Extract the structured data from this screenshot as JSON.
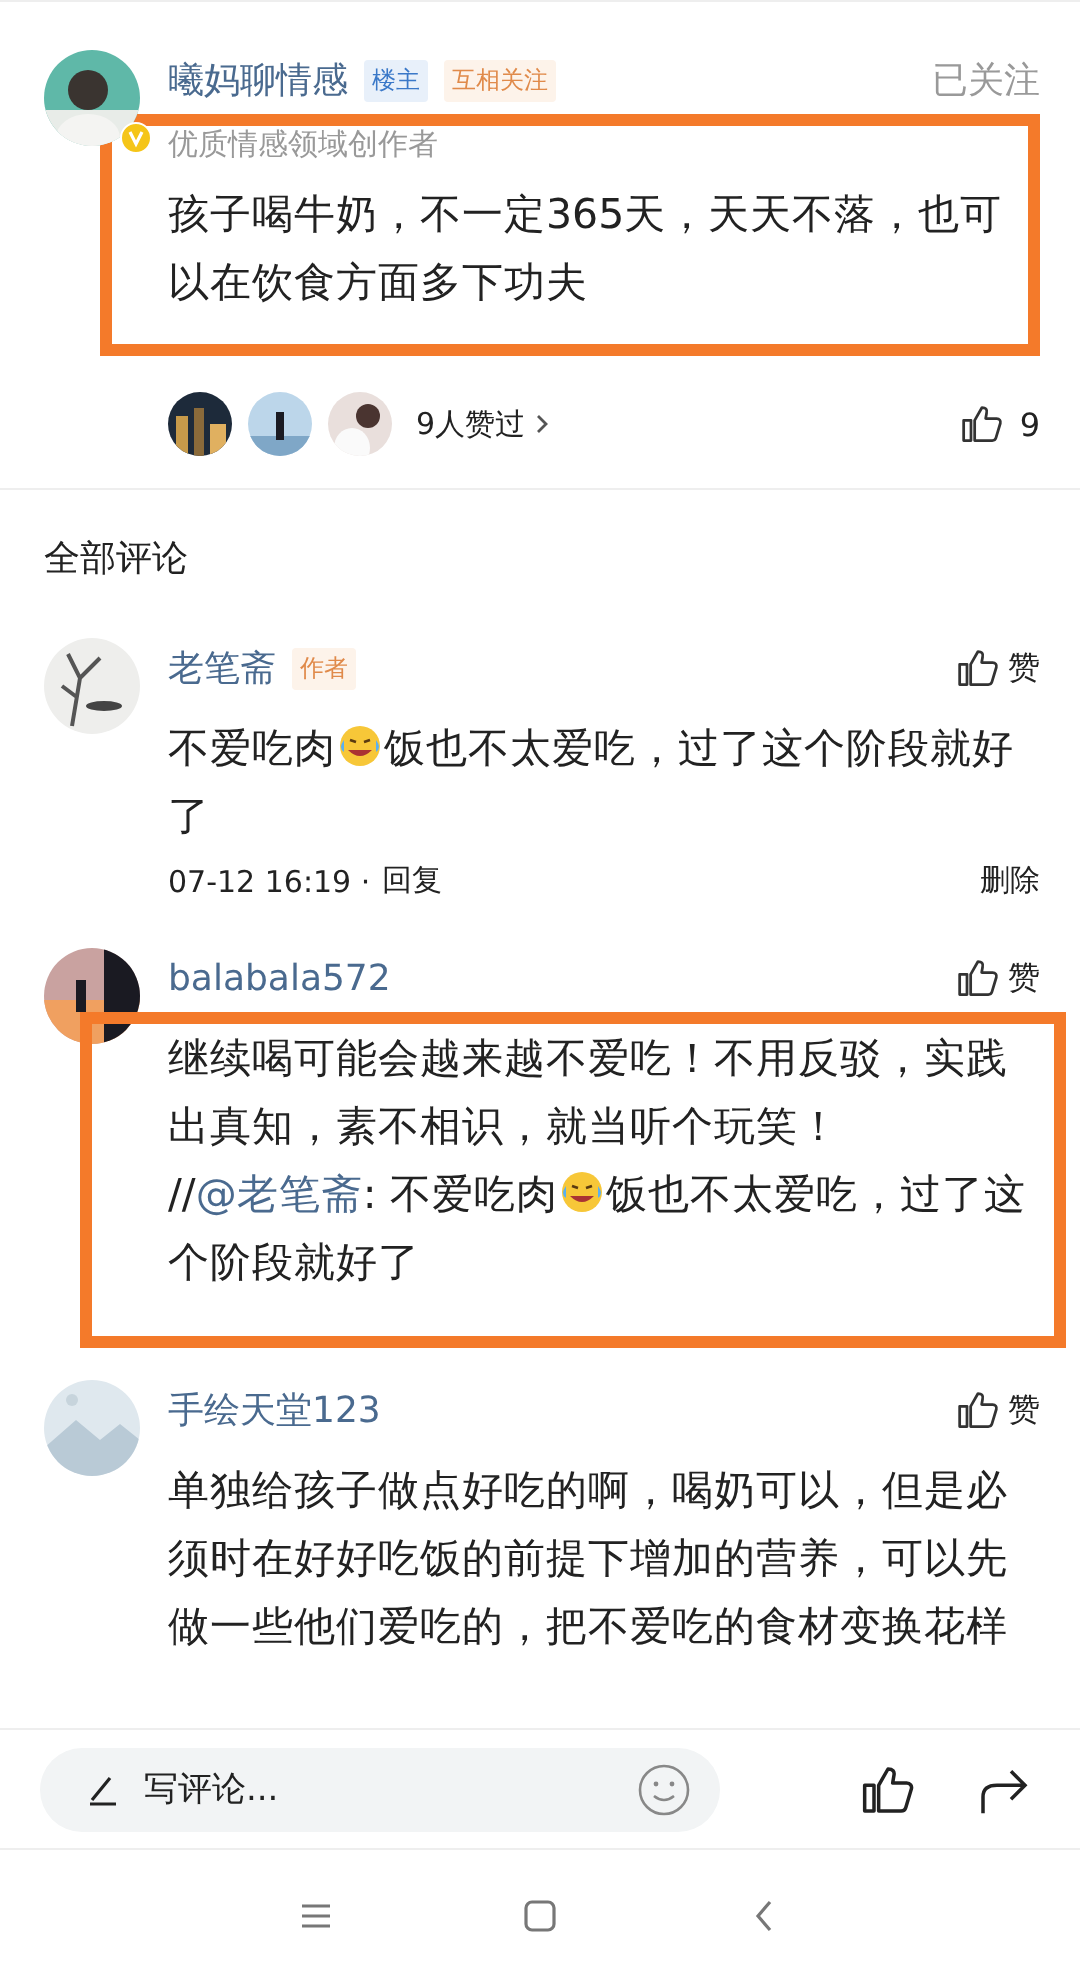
{
  "op_comment": {
    "author": "曦妈聊情感",
    "badges": [
      {
        "kind": "host",
        "text": "楼主"
      },
      {
        "kind": "mutual",
        "text": "互相关注"
      }
    ],
    "follow_status": "已关注",
    "verified": true,
    "highlighted": true,
    "subtitle": "优质情感领域创作者",
    "text": "孩子喝牛奶，不一定365天，天天不落，也可以在饮食方面多下功夫",
    "liked_by": "9人赞过",
    "like_count": "9"
  },
  "section_title": "全部评论",
  "comments": [
    {
      "author": "老笔斋",
      "badges": [
        {
          "kind": "author",
          "text": "作者"
        }
      ],
      "like_label": "赞",
      "highlighted": false,
      "content": [
        {
          "kind": "text",
          "text": "不爱吃肉"
        },
        {
          "kind": "emoji"
        },
        {
          "kind": "text",
          "text": "饭也不太爱吃，过了这个阶段就好了"
        }
      ],
      "time": "07-12 16:19 ·",
      "reply": "回复",
      "delete": "删除"
    },
    {
      "author": "balabala572",
      "like_label": "赞",
      "highlighted": true,
      "content": [
        {
          "kind": "text",
          "text": "继续喝可能会越来越不爱吃！不用反驳，实践出真知，素不相识，就当听个玩笑！ //"
        },
        {
          "kind": "mention",
          "text": "@老笔斋"
        },
        {
          "kind": "text",
          "text": ": 不爱吃肉"
        },
        {
          "kind": "emoji"
        },
        {
          "kind": "text",
          "text": "饭也不太爱吃，过了这个阶段就好了"
        }
      ]
    },
    {
      "author": "手绘天堂123",
      "like_label": "赞",
      "highlighted": false,
      "content": [
        {
          "kind": "text",
          "text": "单独给孩子做点好吃的啊，喝奶可以，但是必须时在好好吃饭的前提下增加的营养，可以先做一些他们爱吃的，把不爱吃的食材变换花样"
        }
      ]
    }
  ],
  "comment_bar": {
    "placeholder": "写评论..."
  }
}
